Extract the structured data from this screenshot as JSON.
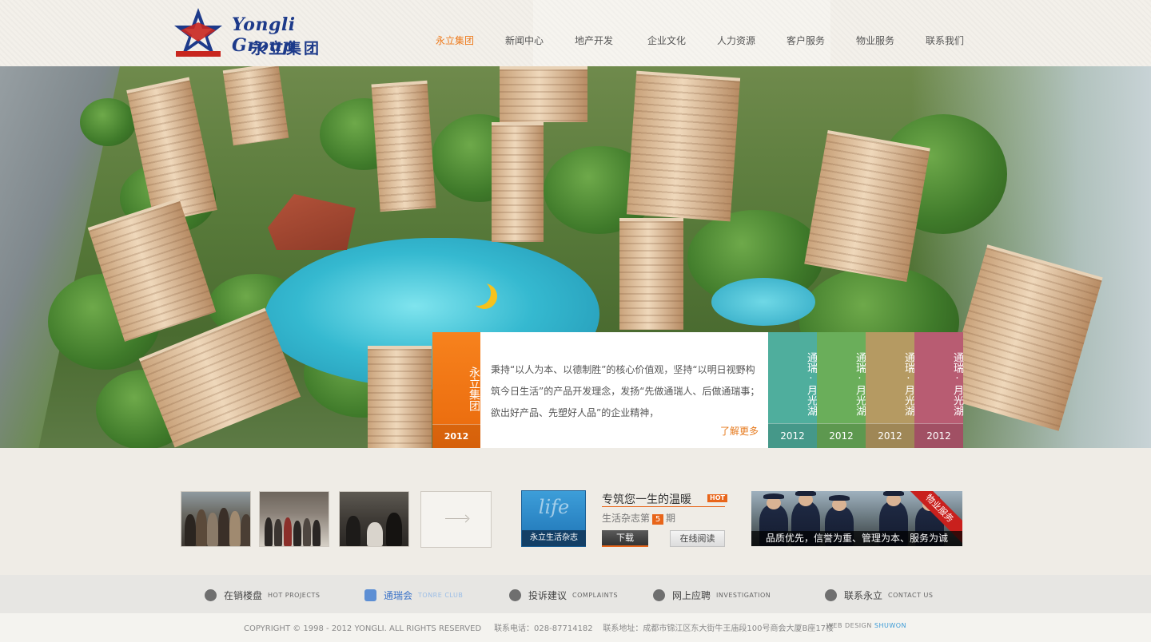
{
  "brand": {
    "name_en": "Yongli Group",
    "name_cn": "永立集团"
  },
  "nav": {
    "items": [
      {
        "label": "永立集团",
        "active": true
      },
      {
        "label": "新闻中心",
        "active": false
      },
      {
        "label": "地产开发",
        "active": false
      },
      {
        "label": "企业文化",
        "active": false
      },
      {
        "label": "人力资源",
        "active": false
      },
      {
        "label": "客户服务",
        "active": false
      },
      {
        "label": "物业服务",
        "active": false
      },
      {
        "label": "联系我们",
        "active": false
      }
    ]
  },
  "intro": {
    "title": "永立集团",
    "year": "2012",
    "text": "秉持“以人为本、以德制胜”的核心价值观，坚持“以明日视野构筑今日生活”的产品开发理念，发扬“先做通瑞人、后做通瑞事；欲出好产品、先塑好人品”的企业精神，",
    "more": "了解更多"
  },
  "projects": [
    {
      "title": "通瑞·月光湖",
      "year": "2012",
      "color": "#4fae9d"
    },
    {
      "title": "通瑞·月光湖",
      "year": "2012",
      "color": "#6aae5a"
    },
    {
      "title": "通瑞·月光湖",
      "year": "2012",
      "color": "#b59a62"
    },
    {
      "title": "通瑞·月光湖",
      "year": "2012",
      "color": "#b85c72"
    }
  ],
  "magazine": {
    "cover_word": "life",
    "cover_label": "永立生活杂志",
    "title": "专筑您一生的温暖",
    "badge": "HOT",
    "issue_prefix": "生活杂志第",
    "issue_number": "5",
    "issue_suffix": "期",
    "download": "下载",
    "read_online": "在线阅读"
  },
  "service": {
    "ribbon": "物业服务",
    "caption": "品质优先，信誉为重、管理为本、服务为诚"
  },
  "quick_links": [
    {
      "cn": "在销楼盘",
      "en": "HOT PROJECTS",
      "icon": "building-icon",
      "highlight": false
    },
    {
      "cn": "通瑞会",
      "en": "TONRE CLUB",
      "icon": "club-icon",
      "highlight": true
    },
    {
      "cn": "投诉建议",
      "en": "COMPLAINTS",
      "icon": "pen-icon",
      "highlight": false
    },
    {
      "cn": "网上应聘",
      "en": "INVESTIGATION",
      "icon": "people-icon",
      "highlight": false
    },
    {
      "cn": "联系永立",
      "en": "CONTACT US",
      "icon": "arrow-right-icon",
      "highlight": false
    }
  ],
  "footer": {
    "copyright": "COPYRIGHT © 1998 - 2012 YONGLI. ALL RIGHTS RESERVED",
    "phone": "联系电话：028-87714182",
    "address": "联系地址：成都市锦江区东大街牛王庙段100号商会大厦B座17楼",
    "design_label": "WEB DESIGN",
    "designer": "SHUWON"
  },
  "colors": {
    "accent": "#ee7a1c",
    "brand_blue": "#1d3a8a",
    "brand_red": "#c8261f"
  }
}
